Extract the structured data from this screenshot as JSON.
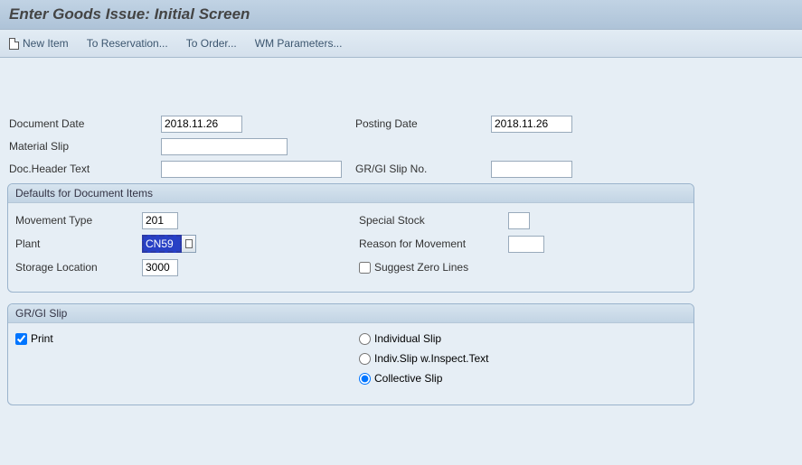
{
  "title": "Enter Goods Issue: Initial Screen",
  "toolbar": {
    "new_item": "New Item",
    "to_reservation": "To Reservation...",
    "to_order": "To Order...",
    "wm_params": "WM Parameters..."
  },
  "header": {
    "document_date_label": "Document Date",
    "document_date_value": "2018.11.26",
    "posting_date_label": "Posting Date",
    "posting_date_value": "2018.11.26",
    "material_slip_label": "Material Slip",
    "material_slip_value": "",
    "doc_header_text_label": "Doc.Header Text",
    "doc_header_text_value": "",
    "gr_gi_slip_no_label": "GR/GI Slip No.",
    "gr_gi_slip_no_value": ""
  },
  "defaults_group": {
    "title": "Defaults for Document Items",
    "movement_type_label": "Movement Type",
    "movement_type_value": "201",
    "special_stock_label": "Special Stock",
    "special_stock_value": "",
    "plant_label": "Plant",
    "plant_value": "CN59",
    "reason_label": "Reason for Movement",
    "reason_value": "",
    "storage_loc_label": "Storage Location",
    "storage_loc_value": "3000",
    "suggest_zero_label": "Suggest Zero Lines",
    "suggest_zero_checked": false
  },
  "slip_group": {
    "title": "GR/GI Slip",
    "print_label": "Print",
    "print_checked": true,
    "options": {
      "individual": "Individual Slip",
      "indiv_inspect": "Indiv.Slip w.Inspect.Text",
      "collective": "Collective Slip"
    },
    "selected": "collective"
  }
}
